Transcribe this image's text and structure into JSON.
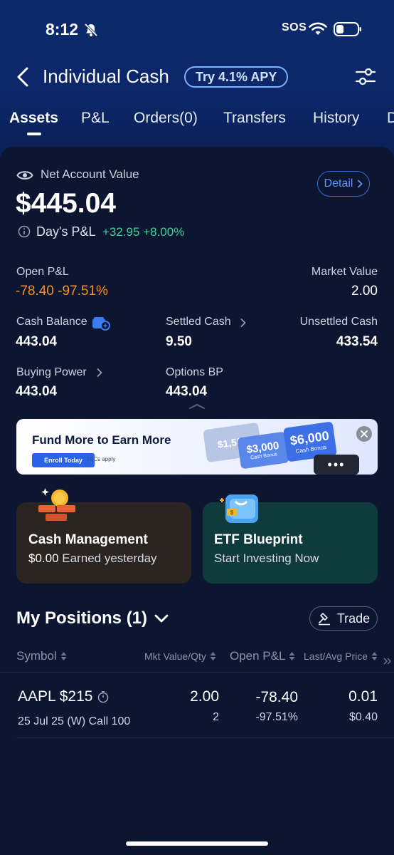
{
  "status_bar": {
    "time": "8:12",
    "sos": "SOS"
  },
  "header": {
    "title": "Individual Cash",
    "apy_badge": "Try 4.1% APY"
  },
  "tabs": [
    "Assets",
    "P&L",
    "Orders(0)",
    "Transfers",
    "History",
    "D"
  ],
  "account": {
    "nav_label": "Net Account Value",
    "nav_value": "$445.04",
    "detail_label": "Detail",
    "days_pl_label": "Day's P&L",
    "days_pl_value": "+32.95 +8.00%",
    "open_pl_label": "Open P&L",
    "open_pl_value": "-78.40 -97.51%",
    "market_value_label": "Market Value",
    "market_value": "2.00",
    "cash_balance_label": "Cash Balance",
    "cash_balance": "443.04",
    "settled_cash_label": "Settled Cash",
    "settled_cash": "9.50",
    "unsettled_cash_label": "Unsettled Cash",
    "unsettled_cash": "433.54",
    "buying_power_label": "Buying Power",
    "buying_power": "443.04",
    "options_bp_label": "Options BP",
    "options_bp": "443.04"
  },
  "banner": {
    "title": "Fund More to Earn More",
    "enroll": "Enroll Today",
    "tcs": "T&Cs apply",
    "card1": "$1,500",
    "card2": "$3,000",
    "card3": "$6,000",
    "card_sub": "Cash Bonus"
  },
  "promos": [
    {
      "title": "Cash Management",
      "amount": "$0.00",
      "sub": "Earned yesterday"
    },
    {
      "title": "ETF Blueprint",
      "sub": "Start Investing Now"
    }
  ],
  "positions": {
    "title": "My Positions (1)",
    "trade_label": "Trade",
    "headers": {
      "symbol": "Symbol",
      "mkt": "Mkt Value/Qty",
      "open_pl": "Open P&L",
      "last_avg": "Last/Avg Price"
    },
    "rows": [
      {
        "symbol": "AAPL $215",
        "contract": "25 Jul 25 (W) Call 100",
        "mkt_value": "2.00",
        "qty": "2",
        "open_pl": "-78.40",
        "open_pl_pct": "-97.51%",
        "last": "0.01",
        "avg": "$0.40"
      }
    ]
  },
  "colors": {
    "accent": "#2f6ad6",
    "gain": "#3bd49a",
    "loss": "#f2922e",
    "background": "#0c1631"
  }
}
